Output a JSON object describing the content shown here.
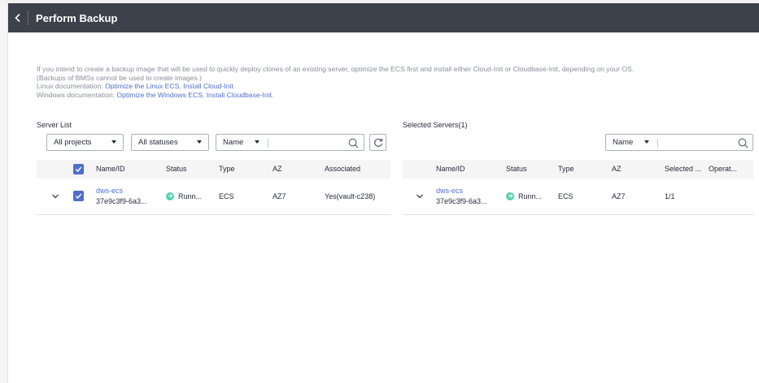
{
  "header": {
    "title": "Perform Backup"
  },
  "notice": {
    "line1": "If you intend to create a backup image that will be used to quickly deploy clones of an existing server, optimize the ECS first and install either Cloud-Init or Cloudbase-Init, depending on your OS.",
    "line2": "(Backups of BMSs cannot be used to create images.)",
    "linux_prefix": "Linux documentation: ",
    "linux_link1": "Optimize the Linux ECS",
    "linux_sep": ", ",
    "linux_link2": "Install Cloud-Init",
    "linux_end": ".",
    "windows_prefix": "Windows documentation: ",
    "windows_link1": "Optimize the Windows ECS",
    "windows_sep": ", ",
    "windows_link2": "Install Cloudbase-Init",
    "windows_end": "."
  },
  "server_list": {
    "title": "Server List",
    "project_filter": "All projects",
    "status_filter": "All statuses",
    "search_field": "Name",
    "search_value": "",
    "columns": [
      "Name/ID",
      "Status",
      "Type",
      "AZ",
      "Associated"
    ],
    "rows": [
      {
        "name": "dws-ecs",
        "id": "37e9c3f9-6a3...",
        "status": "Runn...",
        "type": "ECS",
        "az": "AZ7",
        "associated": "Yes(vault-c238)"
      }
    ]
  },
  "selected_servers": {
    "title": "Selected Servers(1)",
    "search_field": "Name",
    "search_value": "",
    "columns": [
      "Name/ID",
      "Status",
      "Type",
      "AZ",
      "Selected ...",
      "Operat..."
    ],
    "rows": [
      {
        "name": "dws-ecs",
        "id": "37e9c3f9-6a3...",
        "status": "Runn...",
        "type": "ECS",
        "az": "AZ7",
        "selected": "1/1"
      }
    ]
  },
  "icons": {
    "back": "chevron-left-icon",
    "dropdown": "caret-down-icon",
    "search": "search-icon",
    "refresh": "refresh-icon",
    "checkbox": "checkbox-checked-icon",
    "expand": "chevron-down-icon",
    "status": "running-status-icon"
  },
  "colors": {
    "header_bg": "#3d414c",
    "link": "#526ecc",
    "checkbox": "#526ecc",
    "status_running": "#50d4ab",
    "table_header_bg": "#f5f5f6"
  }
}
